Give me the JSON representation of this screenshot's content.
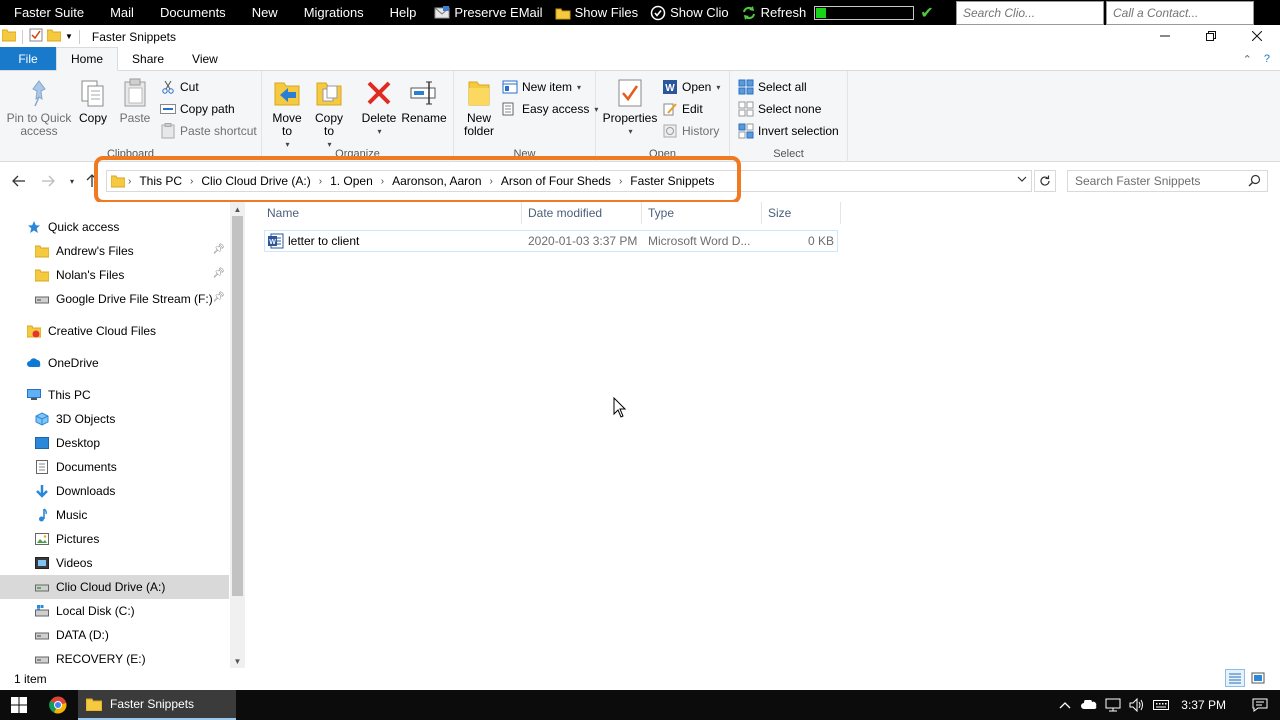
{
  "topbar": {
    "menus": [
      "Faster Suite",
      "Mail",
      "Documents",
      "New",
      "Migrations",
      "Help"
    ],
    "preserve_email": "Preserve EMail",
    "show_files": "Show Files",
    "show_clio": "Show Clio",
    "refresh": "Refresh",
    "refresh_progress_pct": 12,
    "search_clio_placeholder": "Search Clio...",
    "call_contact_placeholder": "Call a Contact..."
  },
  "window": {
    "title": "Faster Snippets"
  },
  "ribbon": {
    "tabs": [
      "File",
      "Home",
      "Share",
      "View"
    ],
    "active_tab": "Home",
    "clipboard": {
      "label": "Clipboard",
      "pin": "Pin to Quick access",
      "copy": "Copy",
      "paste": "Paste",
      "cut": "Cut",
      "copy_path": "Copy path",
      "paste_shortcut": "Paste shortcut"
    },
    "organize": {
      "label": "Organize",
      "move_to": "Move to",
      "copy_to": "Copy to",
      "delete": "Delete",
      "rename": "Rename"
    },
    "new": {
      "label": "New",
      "new_folder": "New folder",
      "new_item": "New item",
      "easy_access": "Easy access"
    },
    "open": {
      "label": "Open",
      "properties": "Properties",
      "open": "Open",
      "edit": "Edit",
      "history": "History"
    },
    "select": {
      "label": "Select",
      "select_all": "Select all",
      "select_none": "Select none",
      "invert_selection": "Invert selection"
    }
  },
  "address": {
    "breadcrumbs": [
      "This PC",
      "Clio Cloud Drive (A:)",
      "1. Open",
      "Aaronson, Aaron",
      "Arson of Four Sheds",
      "Faster Snippets"
    ],
    "search_placeholder": "Search Faster Snippets"
  },
  "navpane": {
    "items": [
      {
        "label": "Quick access",
        "icon": "star-icon"
      },
      {
        "label": "Andrew's Files",
        "icon": "folder-icon",
        "pinned": true
      },
      {
        "label": "Nolan's Files",
        "icon": "folder-icon",
        "pinned": true
      },
      {
        "label": "Google Drive File Stream (F:)",
        "icon": "drive-icon",
        "pinned": true
      },
      {
        "label": "Creative Cloud Files",
        "icon": "creative-cloud-icon"
      },
      {
        "label": "OneDrive",
        "icon": "cloud-icon"
      },
      {
        "label": "This PC",
        "icon": "pc-icon"
      },
      {
        "label": "3D Objects",
        "icon": "cube-icon"
      },
      {
        "label": "Desktop",
        "icon": "desktop-icon"
      },
      {
        "label": "Documents",
        "icon": "document-icon"
      },
      {
        "label": "Downloads",
        "icon": "download-icon"
      },
      {
        "label": "Music",
        "icon": "music-icon"
      },
      {
        "label": "Pictures",
        "icon": "picture-icon"
      },
      {
        "label": "Videos",
        "icon": "video-icon"
      },
      {
        "label": "Clio Cloud Drive (A:)",
        "icon": "drive-icon",
        "selected": true
      },
      {
        "label": "Local Disk (C:)",
        "icon": "windows-drive-icon"
      },
      {
        "label": "DATA (D:)",
        "icon": "drive-icon"
      },
      {
        "label": "RECOVERY (E:)",
        "icon": "drive-icon"
      }
    ]
  },
  "filelist": {
    "columns": [
      "Name",
      "Date modified",
      "Type",
      "Size"
    ],
    "rows": [
      {
        "name": "letter to client",
        "date": "2020-01-03 3:37 PM",
        "type": "Microsoft Word D...",
        "size": "0 KB"
      }
    ]
  },
  "status": {
    "item_count": "1 item"
  },
  "taskbar": {
    "explorer_label": "Faster Snippets",
    "time": "3:37 PM"
  },
  "colors": {
    "highlight": "#f07a22",
    "file_tab": "#1979ca",
    "progress": "#18d318"
  }
}
